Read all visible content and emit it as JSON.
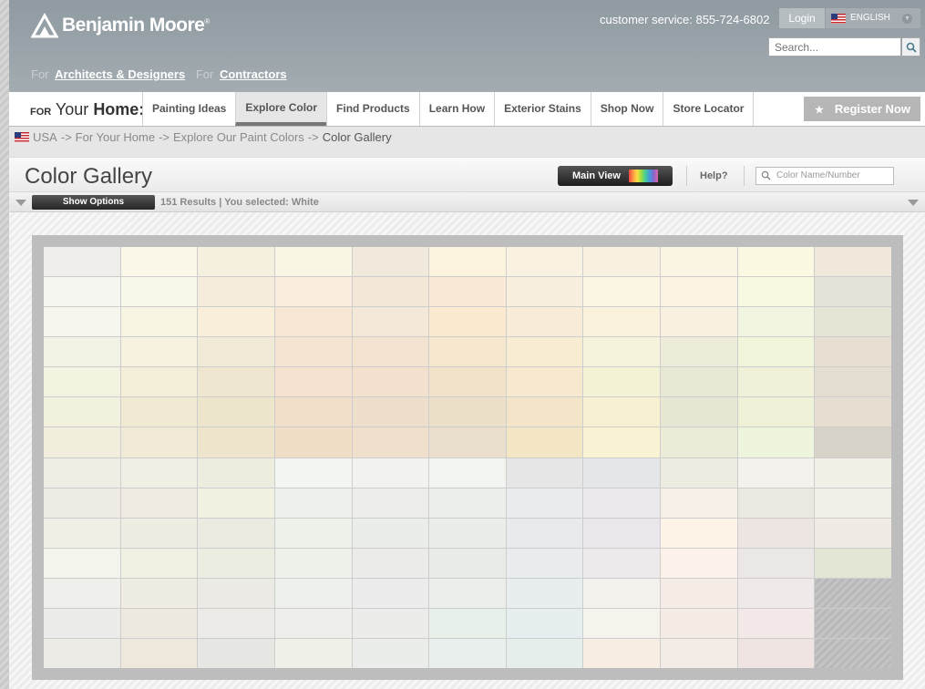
{
  "header": {
    "brand": "Benjamin Moore",
    "brand_mark": "®",
    "for_prefix": "For",
    "for_links": [
      "Architects & Designers",
      "Contractors"
    ],
    "customer_service": "customer service: 855-724-6802",
    "login": "Login",
    "language": "ENGLISH",
    "search_placeholder": "Search..."
  },
  "nav": {
    "for_label": "FOR",
    "your_label": "Your",
    "home_label": "Home:",
    "tabs": [
      "Painting Ideas",
      "Explore Color",
      "Find Products",
      "Learn How",
      "Exterior Stains",
      "Shop Now",
      "Store Locator"
    ],
    "active_tab": "Explore Color",
    "register": "Register Now"
  },
  "breadcrumb": {
    "items": [
      "USA",
      "For Your Home",
      "Explore Our Paint Colors",
      "Color Gallery"
    ],
    "separator": "->"
  },
  "gallery": {
    "title": "Color Gallery",
    "main_view": "Main View",
    "help": "Help?",
    "color_search_placeholder": "Color Name/Number",
    "show_options": "Show Options",
    "results": "151 Results | You selected: White",
    "swatches": [
      [
        "#efeeea",
        "#fbf8e9",
        "#f6f0e1",
        "#f9f6e6",
        "#f1eadc",
        "#fcf3df",
        "#f9f2e3",
        "#f8f1e2",
        "#f9f4e4",
        "#fbf9e2",
        "#f0e9db"
      ],
      [
        "#f6f6f0",
        "#f8f8ea",
        "#f5ecdc",
        "#fbeddd",
        "#f3e8d8",
        "#f8ead6",
        "#f8eedd",
        "#fbf6e3",
        "#faf2e3",
        "#f8f9e1",
        "#e5e3d7"
      ],
      [
        "#f6f6ef",
        "#f8f4e2",
        "#f9efdb",
        "#f7e7d4",
        "#f4e8d9",
        "#fbeacf",
        "#f8ecd8",
        "#faf2db",
        "#f8f0e1",
        "#f2f5e0",
        "#e6e4d5"
      ],
      [
        "#f3f3e5",
        "#f6f2df",
        "#f1ead7",
        "#f4e5d2",
        "#f2e4d1",
        "#f6e7cf",
        "#f8ecd3",
        "#f5f3dc",
        "#edebda",
        "#f1f5da",
        "#e7e0d2"
      ],
      [
        "#f4f3e2",
        "#f4efd9",
        "#efe6d0",
        "#f5e2cf",
        "#f3e0cd",
        "#f2e2c9",
        "#f6e9cf",
        "#f4f2d5",
        "#e9e8d4",
        "#f1f1da",
        "#e3ded1"
      ],
      [
        "#f2f2df",
        "#f1ead2",
        "#eee5cd",
        "#f2dfc9",
        "#eedfcb",
        "#ece0c9",
        "#f4e5c9",
        "#f7f1d2",
        "#e8e7d3",
        "#eff2d6",
        "#e6dfd1"
      ],
      [
        "#f1eedd",
        "#f0ead6",
        "#eee5cc",
        "#f1dec6",
        "#f0dfcb",
        "#eadfcc",
        "#f2e6c4",
        "#f9f3d4",
        "#ecebd8",
        "#eef5dd",
        "#d7d3c8"
      ],
      [
        "#eeeee5",
        "#efefe3",
        "#ededdf",
        "#f2f5f0",
        "#f2f3ef",
        "#f2f5ef",
        "#e5e6e5",
        "#e5e6e7",
        "#eeece0",
        "#f5f1ec",
        "#f3f0e8"
      ],
      [
        "#eeece4",
        "#efebe0",
        "#f2f2e2",
        "#eff2ec",
        "#edeee9",
        "#ecefe9",
        "#e9ecec",
        "#ebe9ec",
        "#f7f0e6",
        "#ebe7e1",
        "#f2eee8"
      ],
      [
        "#efefe6",
        "#efede2",
        "#ecebe2",
        "#eef0ea",
        "#ebedea",
        "#ebede8",
        "#e7ebed",
        "#e9e7eb",
        "#fdf3e6",
        "#ede5e2",
        "#f0ebe5"
      ],
      [
        "#f3f5ed",
        "#f1f1e3",
        "#ecede1",
        "#eef0ea",
        "#ebecea",
        "#e9ece6",
        "#e8ecec",
        "#eeeaec",
        "#fcf2ea",
        "#ebe7e6",
        "#e3e6d5"
      ],
      [
        "#eff0ec",
        "#efede3",
        "#ebeae4",
        "#eef0eb",
        "#ebeceb",
        "#eceeec",
        "#e8eeef",
        "#f5f2ed",
        "#f5ece5",
        "#efe9e9",
        null
      ],
      [
        "#ececea",
        "#ede9df",
        "#ecebe8",
        "#eeefeb",
        "#ecedeb",
        "#e8f0ea",
        "#e7eeef",
        "#f6f2ec",
        "#f3ebe4",
        "#f2e9e8",
        null
      ],
      [
        "#ecebe6",
        "#efe8dc",
        "#e6e6e3",
        "#f0f2ea",
        "#ebedea",
        "#e8efec",
        "#e6eeec",
        "#f8eee4",
        "#f3ebe6",
        "#f0e4e3",
        null
      ]
    ]
  },
  "colors": {
    "header_bg": "#9aa4a9",
    "accent_dark": "#2b2b2b"
  }
}
